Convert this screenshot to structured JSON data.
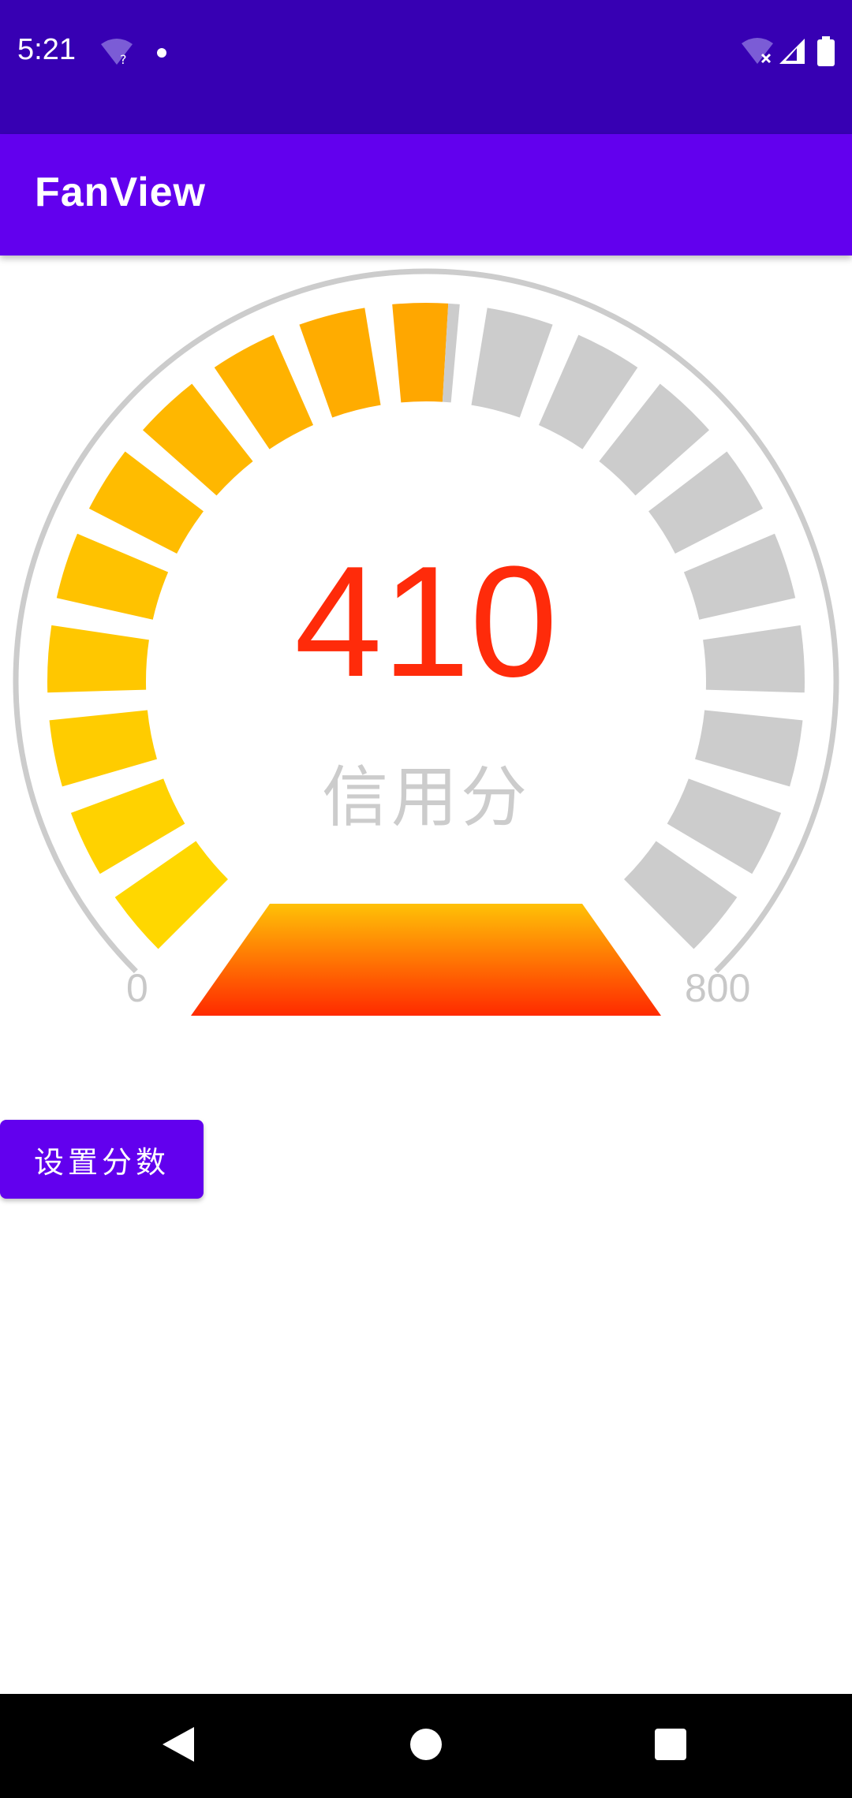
{
  "status_bar": {
    "time": "5:21",
    "background": "#3700b3",
    "icons": [
      "wifi-question-icon",
      "notification-dot-icon",
      "wifi-off-icon",
      "cell-signal-icon",
      "battery-icon"
    ]
  },
  "app_bar": {
    "title": "FanView",
    "background": "#6200ee"
  },
  "gauge": {
    "score": "410",
    "label": "信用分",
    "min_label": "0",
    "max_label": "800",
    "min": 0,
    "max": 800,
    "value": 410,
    "score_color": "#ff2b0a",
    "inactive_color": "#cccccc",
    "gradient_colors": [
      "#ffd700",
      "#ffa500",
      "#ff8c00"
    ],
    "segment_count": 19
  },
  "button": {
    "label": "设置分数"
  },
  "nav_bar": {
    "icons": [
      "back-icon",
      "home-icon",
      "recents-icon"
    ]
  }
}
